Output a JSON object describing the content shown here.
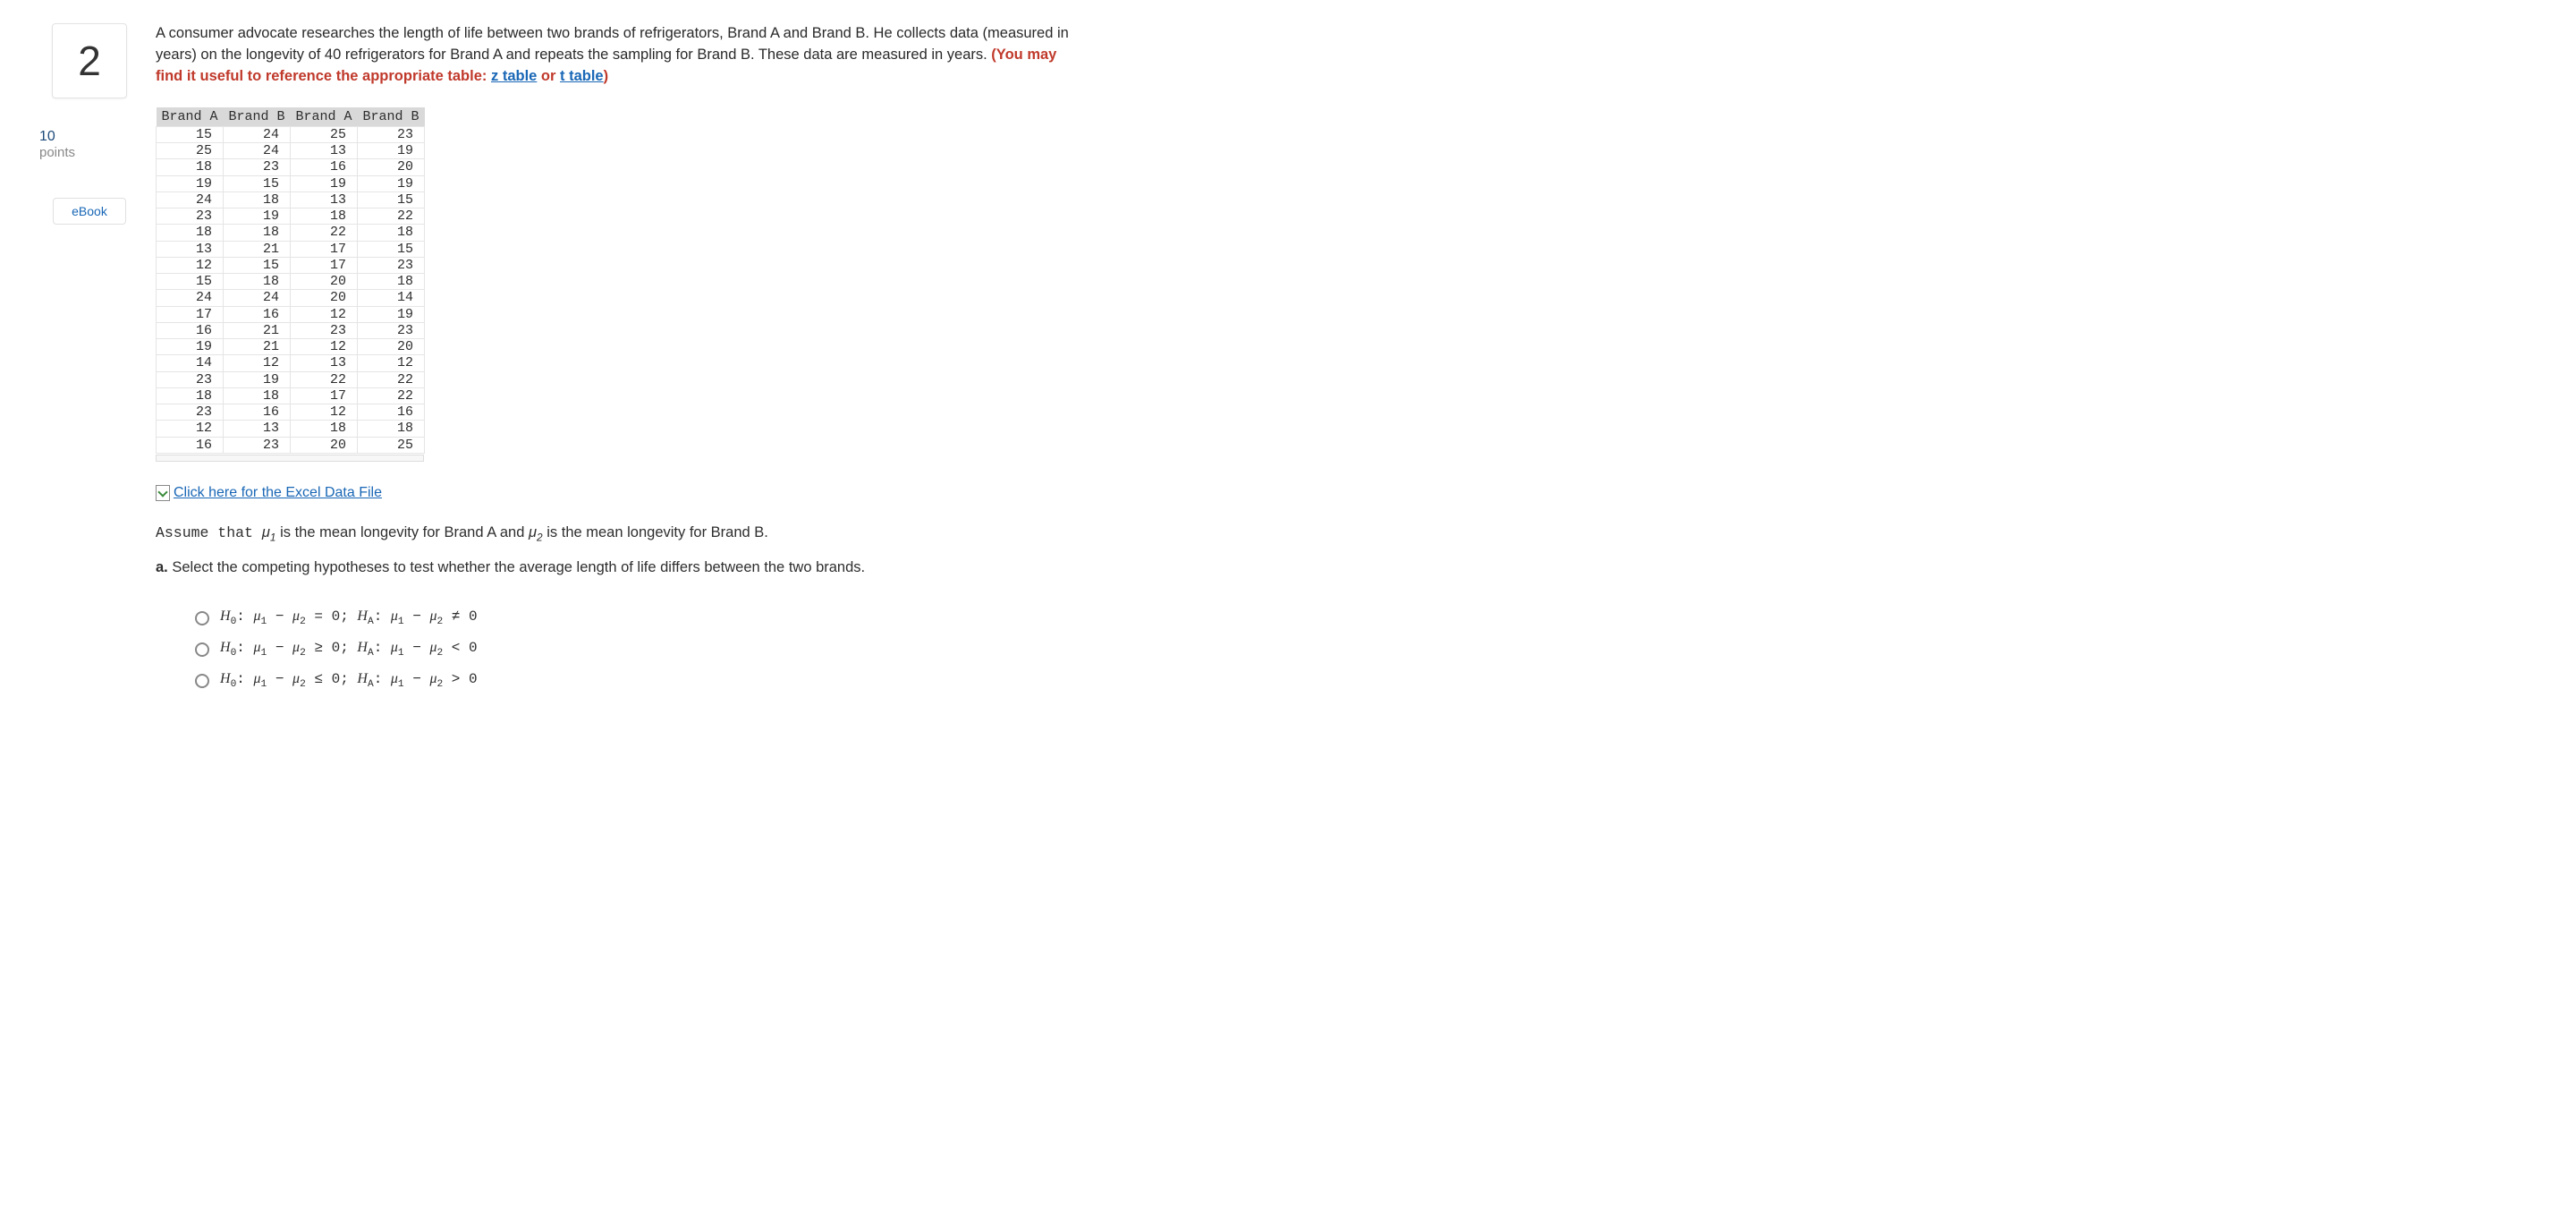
{
  "question_number": "2",
  "points_value": "10",
  "points_label": "points",
  "ebook_label": "eBook",
  "intro_1": "A consumer advocate researches the length of life between two brands of refrigerators, Brand A and Brand B. He collects data (measured in years) on the longevity of 40 refrigerators for Brand A and repeats the sampling for Brand B. These data are measured in years. ",
  "intro_bold": "(You may find it useful to reference the appropriate table: ",
  "z_table": "z table",
  "or_word": " or ",
  "t_table": "t table",
  "close_paren": ")",
  "headers": [
    "Brand A",
    "Brand B",
    "Brand A",
    "Brand B"
  ],
  "chart_data": {
    "type": "table",
    "rows": [
      [
        15,
        24,
        25,
        23
      ],
      [
        25,
        24,
        13,
        19
      ],
      [
        18,
        23,
        16,
        20
      ],
      [
        19,
        15,
        19,
        19
      ],
      [
        24,
        18,
        13,
        15
      ],
      [
        23,
        19,
        18,
        22
      ],
      [
        18,
        18,
        22,
        18
      ],
      [
        13,
        21,
        17,
        15
      ],
      [
        12,
        15,
        17,
        23
      ],
      [
        15,
        18,
        20,
        18
      ],
      [
        24,
        24,
        20,
        14
      ],
      [
        17,
        16,
        12,
        19
      ],
      [
        16,
        21,
        23,
        23
      ],
      [
        19,
        21,
        12,
        20
      ],
      [
        14,
        12,
        13,
        12
      ],
      [
        23,
        19,
        22,
        22
      ],
      [
        18,
        18,
        17,
        22
      ],
      [
        23,
        16,
        12,
        16
      ],
      [
        12,
        13,
        18,
        18
      ],
      [
        16,
        23,
        20,
        25
      ]
    ]
  },
  "excel_link_text": " Click here for the Excel Data File",
  "assume_pre": "Assume that ",
  "mu1_label": "μ1",
  "assume_mid": " is the mean longevity for Brand A and ",
  "mu2_label": "μ2",
  "assume_post": " is the mean longevity for Brand B.",
  "part_a_label": "a.",
  "part_a_text": " Select the competing hypotheses to test whether the average length of life differs between the two brands.",
  "options": [
    {
      "h0": "H0: μ1 − μ2 = 0;",
      "ha": "HA: μ1 − μ2 ≠ 0"
    },
    {
      "h0": "H0: μ1 − μ2 ≥ 0;",
      "ha": "HA: μ1 − μ2 < 0"
    },
    {
      "h0": "H0: μ1 − μ2 ≤ 0;",
      "ha": "HA: μ1 − μ2 > 0"
    }
  ]
}
